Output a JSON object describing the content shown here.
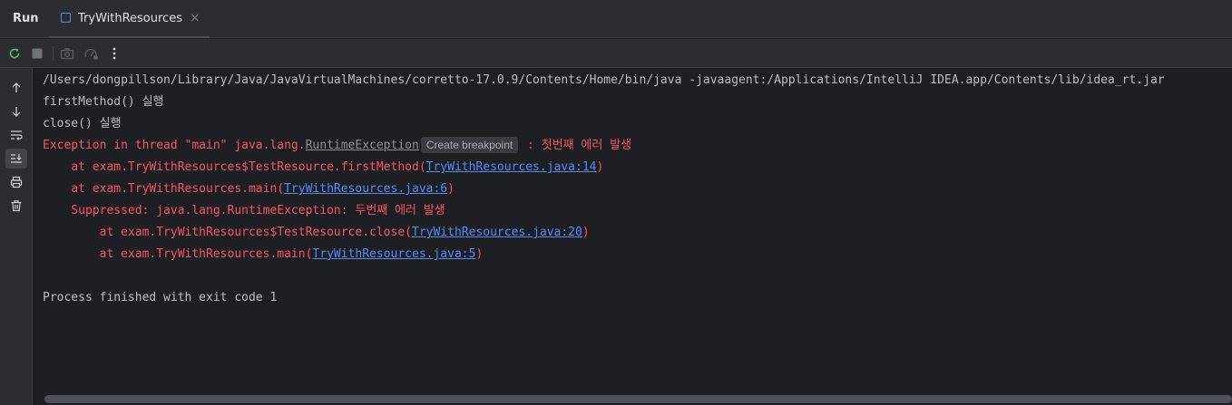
{
  "tool_window": {
    "title": "Run",
    "tab": {
      "label": "TryWithResources",
      "close_glyph": "×",
      "icon": "application-icon"
    }
  },
  "toolbar": {
    "buttons": [
      "rerun-icon",
      "stop-icon",
      "camera-icon",
      "profiler-icon",
      "more-icon"
    ]
  },
  "sidebar": {
    "buttons": [
      "arrow-up-icon",
      "arrow-down-icon",
      "soft-wrap-icon",
      "scroll-to-end-icon",
      "print-icon",
      "trash-icon"
    ],
    "active": "scroll-to-end-icon"
  },
  "console": {
    "command": "/Users/dongpillson/Library/Java/JavaVirtualMachines/corretto-17.0.9/Contents/Home/bin/java -javaagent:/Applications/IntelliJ IDEA.app/Contents/lib/idea_rt.jar",
    "out1": "firstMethod() 실행",
    "out2": "close() 실행",
    "exc_prefix": "Exception in thread \"main\" java.lang.",
    "exc_class": "RuntimeException",
    "tooltip": "Create breakpoint",
    "exc_message": " : 첫번째 에러 발생",
    "trace": [
      {
        "prefix": "    at exam.TryWithResources$TestResource.firstMethod(",
        "link": "TryWithResources.java:14",
        "suffix": ")"
      },
      {
        "prefix": "    at exam.TryWithResources.main(",
        "link": "TryWithResources.java:6",
        "suffix": ")"
      }
    ],
    "suppressed": "    Suppressed: java.lang.RuntimeException: 두번째 에러 발생",
    "suppressed_trace": [
      {
        "prefix": "        at exam.TryWithResources$TestResource.close(",
        "link": "TryWithResources.java:20",
        "suffix": ")"
      },
      {
        "prefix": "        at exam.TryWithResources.main(",
        "link": "TryWithResources.java:5",
        "suffix": ")"
      }
    ],
    "finish": "Process finished with exit code 1"
  },
  "colors": {
    "background": "#1e1f22",
    "panel": "#2b2d30",
    "text": "#bcbec4",
    "error": "#f75464",
    "link": "#548af7",
    "run_green": "#5fb865"
  }
}
